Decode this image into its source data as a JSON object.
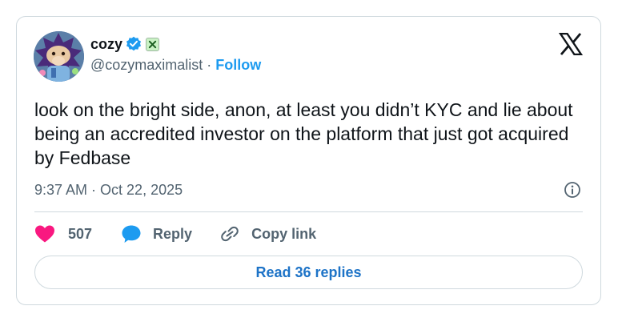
{
  "author": {
    "display_name": "cozy",
    "handle": "@cozymaximalist",
    "separator": "·",
    "follow_label": "Follow"
  },
  "tweet": {
    "text": "look on the bright side, anon, at least you didn’t KYC and lie about being an accredited investor on the platform that just got acquired by Fedbase",
    "time": "9:37 AM",
    "date_separator": "·",
    "date": "Oct 22, 2025"
  },
  "actions": {
    "like_count": "507",
    "reply_label": "Reply",
    "copy_label": "Copy link"
  },
  "read_replies_label": "Read 36 replies",
  "icons": {
    "verified": "verified-badge-icon",
    "affiliate": "affiliate-badge-icon",
    "logo": "x-logo-icon",
    "info": "info-icon",
    "like": "heart-icon",
    "reply": "speech-bubble-icon",
    "copy": "link-icon"
  },
  "colors": {
    "accent": "#1d9bf0",
    "like": "#f91880",
    "text": "#0f1419",
    "muted": "#536471",
    "border": "#cfd9de"
  }
}
